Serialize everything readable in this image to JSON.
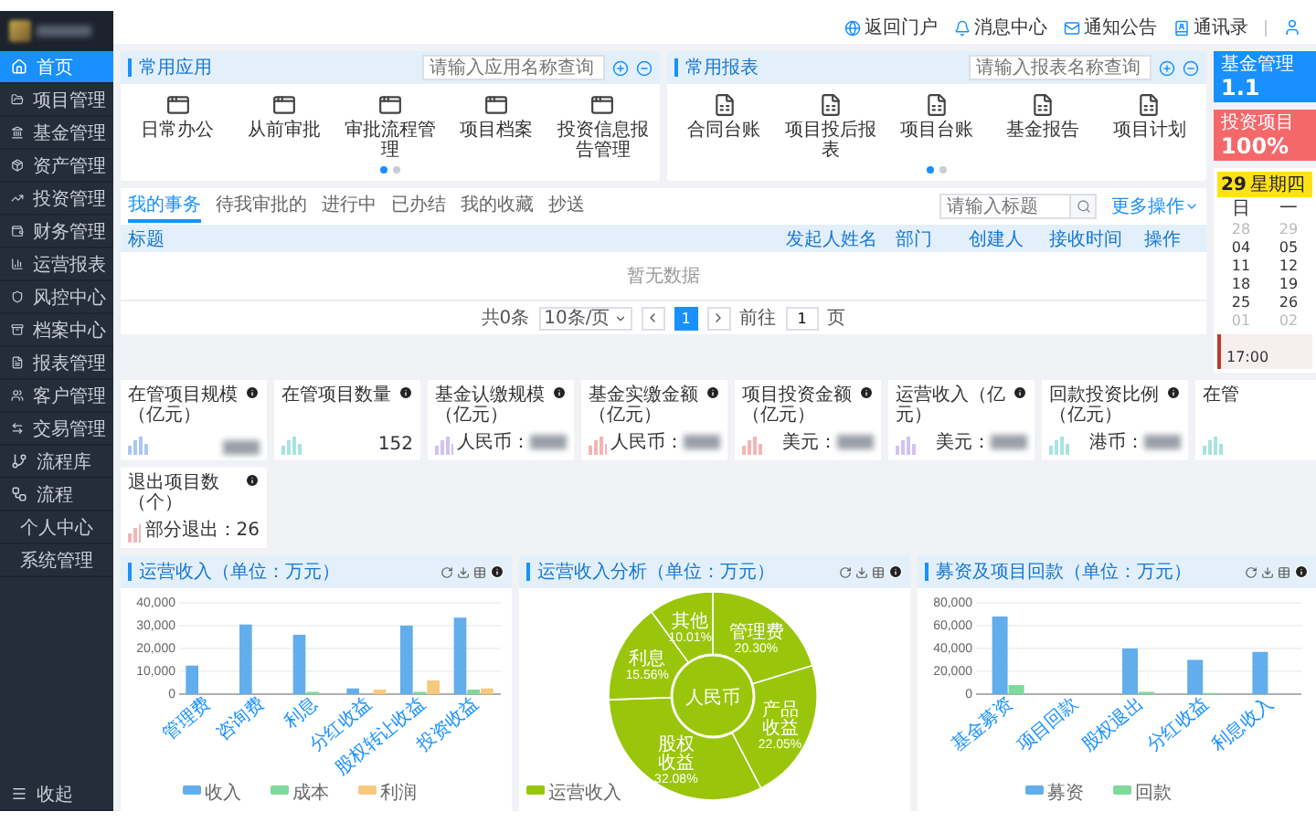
{
  "sidebar": {
    "items": [
      {
        "label": "首页",
        "selected": true,
        "kind": "link"
      },
      {
        "label": "项目管理",
        "selected": false,
        "kind": "link"
      },
      {
        "label": "基金管理",
        "selected": false,
        "kind": "link"
      },
      {
        "label": "资产管理",
        "selected": false,
        "kind": "link"
      },
      {
        "label": "投资管理",
        "selected": false,
        "kind": "link"
      },
      {
        "label": "财务管理",
        "selected": false,
        "kind": "link"
      },
      {
        "label": "运营报表",
        "selected": false,
        "kind": "link"
      },
      {
        "label": "风控中心",
        "selected": false,
        "kind": "link"
      },
      {
        "label": "档案中心",
        "selected": false,
        "kind": "link"
      },
      {
        "label": "报表管理",
        "selected": false,
        "kind": "link"
      },
      {
        "label": "客户管理",
        "selected": false,
        "kind": "link"
      },
      {
        "label": "交易管理",
        "selected": false,
        "kind": "link"
      },
      {
        "label": "流程库",
        "selected": false,
        "kind": "link"
      },
      {
        "label": "流程",
        "selected": false,
        "kind": "link"
      },
      {
        "label": "个人中心",
        "selected": false,
        "kind": "group"
      },
      {
        "label": "系统管理",
        "selected": false,
        "kind": "group"
      }
    ],
    "collapse": "收起"
  },
  "header": {
    "links": [
      "返回门户",
      "消息中心",
      "通知公告",
      "通讯录"
    ]
  },
  "panels": [
    {
      "title": "常用应用",
      "kind": "apps",
      "placeholder": "请输入应用名称查询",
      "items": [
        "日常办公",
        "从前审批",
        "审批流程管理",
        "项目档案",
        "投资信息报告管理"
      ],
      "pages": [
        {
          "selected": true
        },
        {
          "selected": false
        }
      ]
    },
    {
      "title": "常用报表",
      "kind": "reports",
      "placeholder": "请输入报表名称查询",
      "items": [
        "合同台账",
        "项目投后报表",
        "项目台账",
        "基金报告",
        "项目计划"
      ],
      "pages": [
        {
          "selected": true
        },
        {
          "selected": false
        }
      ]
    }
  ],
  "table": {
    "tabs": [
      {
        "label": "我的事务",
        "selected": true
      },
      {
        "label": "待我审批的",
        "selected": false
      },
      {
        "label": "进行中",
        "selected": false
      },
      {
        "label": "已办结",
        "selected": false
      },
      {
        "label": "我的收藏",
        "selected": false
      },
      {
        "label": "抄送",
        "selected": false
      }
    ],
    "placeholder": "请输入标题",
    "more": "更多操作",
    "columns": [
      "标题",
      "发起人姓名",
      "部门",
      "创建人",
      "接收时间",
      "操作"
    ],
    "empty": "暂无数据",
    "pagination": {
      "total": "共0条",
      "page_size": "10条/页",
      "pages": [
        {
          "label": "1",
          "selected": true
        }
      ],
      "goto": "前往",
      "goto_value": "1",
      "goto_unit": "页"
    }
  },
  "right": {
    "cards": [
      {
        "title": "基金管理",
        "value": "1.1",
        "color": "#1890ff"
      },
      {
        "title": "投资项目",
        "value": "100%",
        "color": "#f5686a"
      }
    ],
    "calendar": {
      "day": "29",
      "weekday": "星期四",
      "weekdays": [
        "日",
        "一"
      ],
      "weeks": [
        [
          {
            "label": "28",
            "muted": true
          },
          {
            "label": "29",
            "muted": true
          }
        ],
        [
          {
            "label": "04",
            "muted": false
          },
          {
            "label": "05",
            "muted": false
          }
        ],
        [
          {
            "label": "11",
            "muted": false
          },
          {
            "label": "12",
            "muted": false
          }
        ],
        [
          {
            "label": "18",
            "muted": false
          },
          {
            "label": "19",
            "muted": false
          }
        ],
        [
          {
            "label": "25",
            "muted": false
          },
          {
            "label": "26",
            "muted": false
          }
        ],
        [
          {
            "label": "01",
            "muted": true
          },
          {
            "label": "02",
            "muted": true
          }
        ]
      ],
      "event_time": "17:00"
    }
  },
  "stats": [
    {
      "title": "在管项目规模（亿元）",
      "redacted": true,
      "color": "#a9c8f2"
    },
    {
      "title": "在管项目数量",
      "value": "152",
      "redacted": false,
      "color": "#a8e3e0"
    },
    {
      "title": "基金认缴规模（亿元）",
      "prefix": "人民币：",
      "redacted": true,
      "color": "#d2c2f2"
    },
    {
      "title": "基金实缴金额（亿元）",
      "prefix": "人民币：",
      "redacted": true,
      "color": "#f5b4b4"
    },
    {
      "title": "项目投资金额（亿元）",
      "prefix": "美元：",
      "redacted": true,
      "color": "#f5b4b4"
    },
    {
      "title": "运营收入（亿元）",
      "prefix": "美元：",
      "redacted": true,
      "color": "#d2c2f2"
    },
    {
      "title": "回款投资比例（亿元）",
      "prefix": "港币：",
      "redacted": true,
      "color": "#a8e3e0"
    },
    {
      "title": "在管",
      "redacted": false,
      "color": "#a8e3e0"
    },
    {
      "title": "退出项目数（个）",
      "value": "部分退出：26",
      "redacted": false,
      "color": "#f5b4b4"
    }
  ],
  "charts": [
    {
      "title": "运营收入（单位：万元）",
      "chart_data": {
        "type": "bar",
        "categories": [
          "管理费",
          "咨询费",
          "利息",
          "分红收益",
          "股权转让收益",
          "投资收益"
        ],
        "series": [
          {
            "name": "收入",
            "color": "#62aeec",
            "values": [
              12500,
              30500,
              26000,
              2500,
              30000,
              33500
            ]
          },
          {
            "name": "成本",
            "color": "#7ed99a",
            "values": [
              0,
              0,
              1000,
              0,
              1000,
              2000
            ]
          },
          {
            "name": "利润",
            "color": "#f7c97e",
            "values": [
              0,
              0,
              0,
              2000,
              6000,
              2500
            ]
          }
        ],
        "grid": true,
        "legend": true,
        "ylim": [
          0,
          40000
        ],
        "yticks": [
          {
            "value": 0,
            "label": "0"
          },
          {
            "value": 10000,
            "label": "10,000"
          },
          {
            "value": 20000,
            "label": "20,000"
          },
          {
            "value": 30000,
            "label": "30,000"
          },
          {
            "value": 40000,
            "label": "40,000"
          }
        ]
      }
    },
    {
      "title": "运营收入分析（单位：万元）",
      "center_label": "人民币",
      "chart_data": {
        "type": "donut",
        "legend": true,
        "categories": [
          "管理费",
          "产品收益",
          "股权收益",
          "利息",
          "其他"
        ],
        "series": [
          {
            "name": "运营收入",
            "color": "#99c60a",
            "values": [
              20.3,
              22.05,
              32.08,
              15.56,
              10.01
            ]
          }
        ],
        "value_labels": [
          "20.30%",
          "22.05%",
          "32.08%",
          "15.56%",
          "10.01%"
        ]
      }
    },
    {
      "title": "募资及项目回款（单位：万元）",
      "chart_data": {
        "type": "bar",
        "categories": [
          "基金募资",
          "项目回款",
          "股权退出",
          "分红收益",
          "利息收入"
        ],
        "series": [
          {
            "name": "募资",
            "color": "#62aeec",
            "values": [
              68000,
              0,
              40000,
              30000,
              37000
            ]
          },
          {
            "name": "回款",
            "color": "#7ed99a",
            "values": [
              8000,
              0,
              2000,
              1000,
              0
            ]
          }
        ],
        "grid": true,
        "legend": true,
        "ylim": [
          0,
          80000
        ],
        "yticks": [
          {
            "value": 0,
            "label": "0"
          },
          {
            "value": 20000,
            "label": "20,000"
          },
          {
            "value": 40000,
            "label": "40,000"
          },
          {
            "value": 60000,
            "label": "60,000"
          },
          {
            "value": 80000,
            "label": "80,000"
          }
        ]
      }
    }
  ]
}
